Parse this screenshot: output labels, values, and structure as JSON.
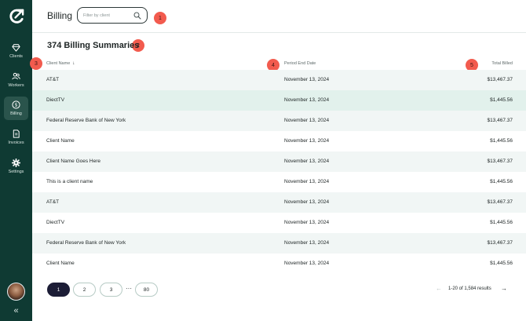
{
  "sidebar": {
    "items": [
      {
        "label": "Clients",
        "icon": "gem-icon"
      },
      {
        "label": "Workers",
        "icon": "workers-icon"
      },
      {
        "label": "Billing",
        "icon": "dollar-icon"
      },
      {
        "label": "Invoices",
        "icon": "invoice-icon"
      },
      {
        "label": "Settings",
        "icon": "gear-icon"
      }
    ],
    "active": "Billing",
    "collapse_glyph": "«"
  },
  "header": {
    "title": "Billing",
    "search_placeholder": "Filter by client"
  },
  "badges": [
    "1",
    "2",
    "3",
    "4",
    "5"
  ],
  "summary": {
    "title": "374 Billing Summaries"
  },
  "table": {
    "columns": [
      "Client Name",
      "Period End Date",
      "Total Billed"
    ],
    "sort_arrow": "↓",
    "rows": [
      {
        "client": "AT&T",
        "period_end": "November 13, 2024",
        "total": "$13,467.37"
      },
      {
        "client": "DiectTV",
        "period_end": "November 13, 2024",
        "total": "$1,445.56"
      },
      {
        "client": "Federal Reserve Bank of New York",
        "period_end": "November 13, 2024",
        "total": "$13,467.37"
      },
      {
        "client": "Client Name",
        "period_end": "November 13, 2024",
        "total": "$1,445.56"
      },
      {
        "client": "Client Name Goes Here",
        "period_end": "November 13, 2024",
        "total": "$13,467.37"
      },
      {
        "client": "This is a client name",
        "period_end": "November 13, 2024",
        "total": "$1,445.56"
      },
      {
        "client": "AT&T",
        "period_end": "November 13, 2024",
        "total": "$13,467.37"
      },
      {
        "client": "DiectTV",
        "period_end": "November 13, 2024",
        "total": "$1,445.56"
      },
      {
        "client": "Federal Reserve Bank of New York",
        "period_end": "November 13, 2024",
        "total": "$13,467.37"
      },
      {
        "client": "Client Name",
        "period_end": "November 13, 2024",
        "total": "$1,445.56"
      }
    ]
  },
  "pagination": {
    "pages": [
      "1",
      "2",
      "3"
    ],
    "ellipsis": "···",
    "last_page": "80",
    "results_text": "1-20 of 1,584 results",
    "prev_glyph": "←",
    "next_glyph": "→"
  },
  "colors": {
    "sidebar_bg": "#0f3a33",
    "badge": "#f25b4e",
    "active_page": "#1c1d36",
    "row_alt": "#f1f6f5",
    "row_highlight": "#e2f1ec"
  }
}
